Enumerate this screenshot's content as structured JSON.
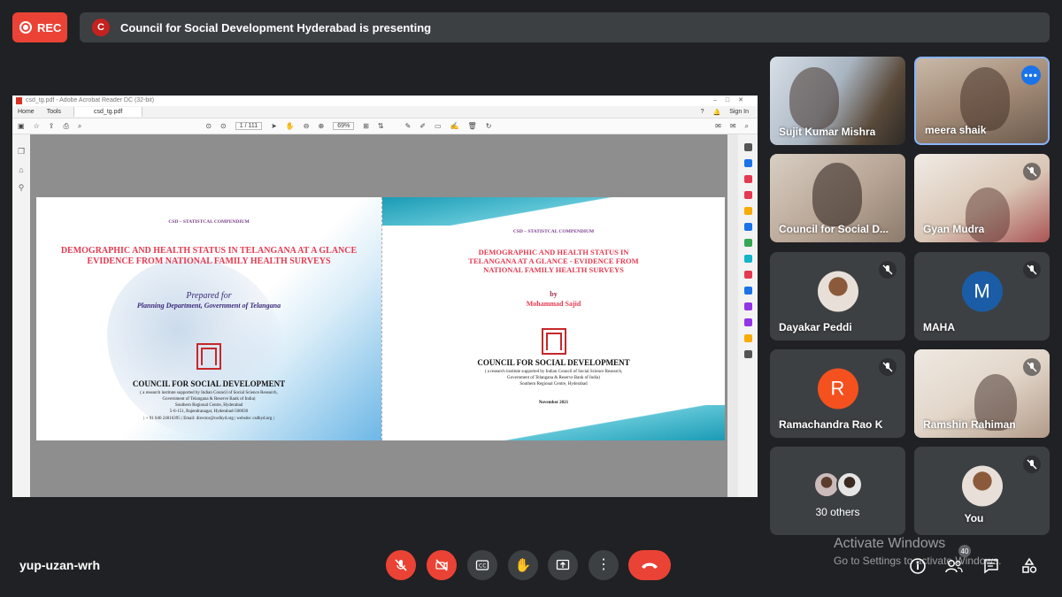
{
  "recording": {
    "label": "REC"
  },
  "presenting_bar": {
    "badge_letter": "C",
    "text": "Council for Social Development Hyderabad is presenting"
  },
  "shared_screen": {
    "window_title": "csd_tg.pdf - Adobe Acrobat Reader DC (32-bit)",
    "menu": {
      "home": "Home",
      "tools": "Tools",
      "file_tab": "csd_tg.pdf",
      "help": "?",
      "sign_in": "Sign In"
    },
    "toolbar": {
      "page_indicator": "1 / 111",
      "zoom": "69%"
    },
    "left_page": {
      "series": "CSD – STATISTCAL COMPENDIUM",
      "title_line1": "DEMOGRAPHIC AND HEALTH STATUS IN TELANGANA AT A GLANCE",
      "title_line2": "EVIDENCE FROM  NATIONAL FAMILY HEALTH SURVEYS",
      "prepared_for": "Prepared for",
      "prepared_for_org": "Planning Department, Government of Telangana",
      "org": "COUNCIL FOR SOCIAL DEVELOPMENT",
      "org_line1": "( a research institute supported by Indian Council of Social Science Research,",
      "org_line2": "Government of Telangana & Reserve Bank of India)",
      "org_line3": "Southern Regional Centre, Hyderabad",
      "org_line4": "5-6-151, Rajendranagar, Hyderabad-500030",
      "org_line5": "| + 91 040 24016395 | Email: director@csdhyd.org | website: csdhyd.org |"
    },
    "right_page": {
      "series": "CSD – STATISTCAL COMPENDIUM",
      "title_line1": "DEMOGRAPHIC AND HEALTH STATUS IN",
      "title_line2": "TELANGANA AT A GLANCE - EVIDENCE FROM",
      "title_line3": "NATIONAL FAMILY HEALTH SURVEYS",
      "by": "by",
      "author": "Mohammad Sajid",
      "org": "COUNCIL FOR SOCIAL DEVELOPMENT",
      "org_line1": "( a research institute supported by Indian Council of Social Science Research,",
      "org_line2": "Government of Telangana & Reserve Bank of India)",
      "org_line3": "Southern Regional Centre, Hyderabad",
      "date": "November 2021"
    }
  },
  "participants": [
    {
      "name": "Sujit Kumar Mishra"
    },
    {
      "name": "meera shaik"
    },
    {
      "name": "Council for Social D..."
    },
    {
      "name": "Gyan Mudra"
    },
    {
      "name": "Dayakar Peddi"
    },
    {
      "name": "MAHA",
      "initial": "M"
    },
    {
      "name": "Ramachandra Rao K",
      "initial": "R"
    },
    {
      "name": "Ramshin Rahiman"
    },
    {
      "name": "30 others"
    },
    {
      "name": "You"
    }
  ],
  "bottom_bar": {
    "meeting_code": "yup-uzan-wrh",
    "participant_count": "40"
  },
  "watermark": {
    "line1": "Activate Windows",
    "line2": "Go to Settings to activate Windows."
  },
  "colors": {
    "background": "#202124",
    "tile": "#3c4043",
    "danger": "#ea4335",
    "accent": "#1a73e8",
    "maha_avatar": "#1a5da6",
    "rama_avatar": "#f4511e"
  }
}
